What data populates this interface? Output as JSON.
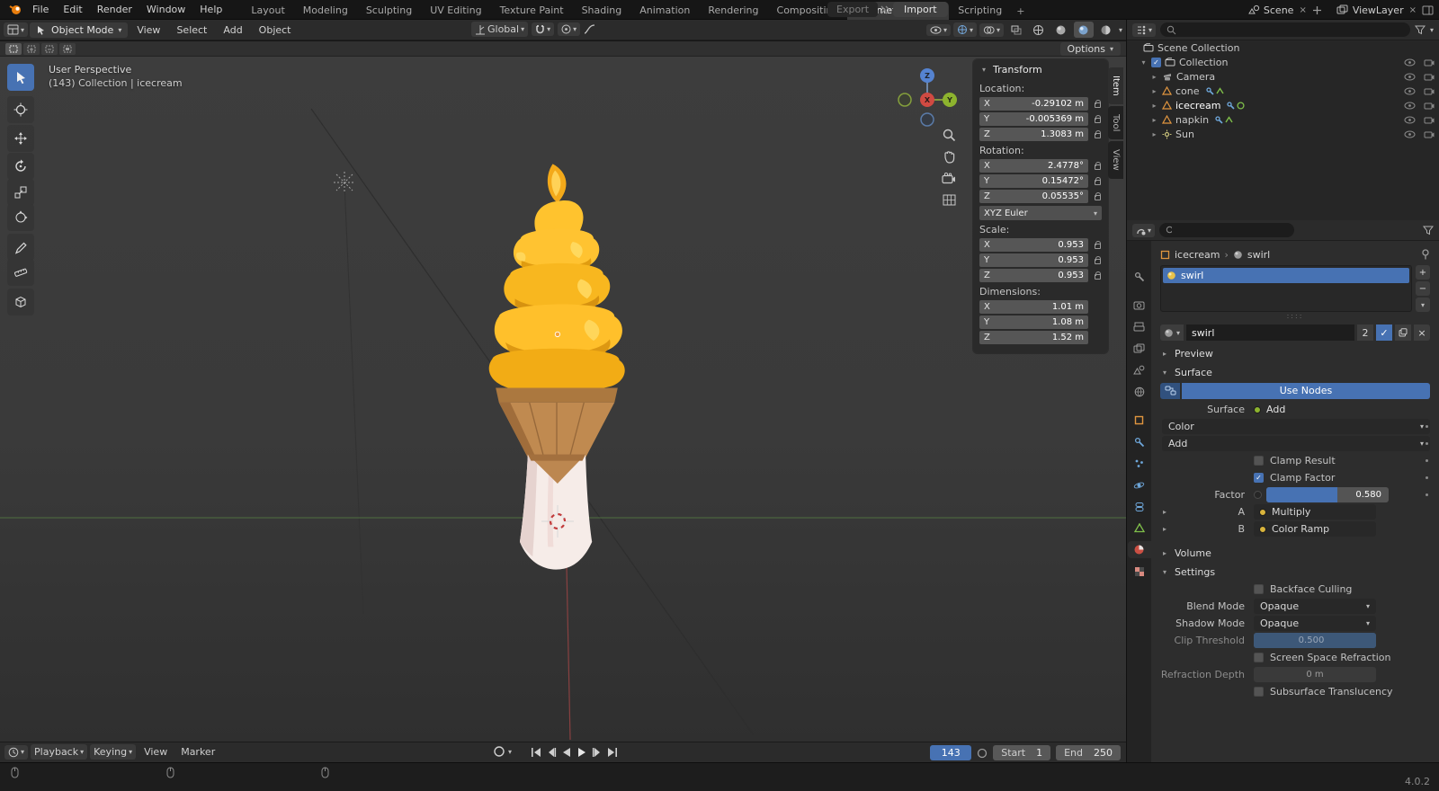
{
  "icons": {
    "chevron_down": "▾",
    "caret_right": "▸",
    "caret_down": "▾",
    "close": "×",
    "plus": "+",
    "minus": "−",
    "check": "✓",
    "handle_dots": "::::",
    "breadcrumb_sep": "›"
  },
  "topbar": {
    "menus": [
      "File",
      "Edit",
      "Render",
      "Window",
      "Help"
    ],
    "workspaces": [
      "Layout",
      "Modeling",
      "Sculpting",
      "UV Editing",
      "Texture Paint",
      "Shading",
      "Animation",
      "Rendering",
      "Compositing",
      "Geometry Nodes",
      "Scripting"
    ],
    "add_tab": "+",
    "export_label": "Export",
    "import_label": "Import",
    "scene_label": "Scene",
    "viewlayer_label": "ViewLayer"
  },
  "viewport_header": {
    "mode": "Object Mode",
    "menus": [
      "View",
      "Select",
      "Add",
      "Object"
    ],
    "orientation": "Global",
    "options_label": "Options"
  },
  "viewport": {
    "view_label": "User Perspective",
    "context_label": "(143) Collection | icecream",
    "gizmo": {
      "x": "X",
      "y": "Y",
      "z": "Z"
    }
  },
  "npanel": {
    "title": "Transform",
    "location_label": "Location:",
    "rotation_label": "Rotation:",
    "scale_label": "Scale:",
    "dimensions_label": "Dimensions:",
    "axis": {
      "x": "X",
      "y": "Y",
      "z": "Z"
    },
    "location": {
      "x": "-0.29102 m",
      "y": "-0.005369 m",
      "z": "1.3083 m"
    },
    "rotation": {
      "x": "2.4778°",
      "y": "0.15472°",
      "z": "0.05535°"
    },
    "euler_mode": "XYZ Euler",
    "scale": {
      "x": "0.953",
      "y": "0.953",
      "z": "0.953"
    },
    "dimensions": {
      "x": "1.01 m",
      "y": "1.08 m",
      "z": "1.52 m"
    },
    "tabs": [
      "Item",
      "Tool",
      "View"
    ]
  },
  "outliner": {
    "scene_collection": "Scene Collection",
    "collection": "Collection",
    "items": [
      {
        "name": "Camera"
      },
      {
        "name": "cone"
      },
      {
        "name": "icecream"
      },
      {
        "name": "napkin"
      },
      {
        "name": "Sun"
      }
    ]
  },
  "properties": {
    "breadcrumb": {
      "object": "icecream",
      "material": "swirl"
    },
    "slot": {
      "name": "swirl"
    },
    "material": {
      "name": "swirl",
      "users": "2"
    },
    "panels": {
      "preview": "Preview",
      "surface": "Surface",
      "volume": "Volume",
      "settings": "Settings"
    },
    "surface": {
      "use_nodes": "Use Nodes",
      "surface_label": "Surface",
      "surface_value": "Add",
      "color_label": "Color",
      "blend_label": "Add",
      "clamp_result": "Clamp Result",
      "clamp_factor": "Clamp Factor",
      "factor_label": "Factor",
      "factor_value": "0.580",
      "a_label": "A",
      "a_value": "Multiply",
      "b_label": "B",
      "b_value": "Color Ramp"
    },
    "settings": {
      "backface": "Backface Culling",
      "blend_mode_label": "Blend Mode",
      "blend_mode": "Opaque",
      "shadow_mode_label": "Shadow Mode",
      "shadow_mode": "Opaque",
      "clip_label": "Clip Threshold",
      "clip_value": "0.500",
      "ssr": "Screen Space Refraction",
      "refraction_label": "Refraction Depth",
      "refraction_value": "0 m",
      "subsurface": "Subsurface Translucency"
    }
  },
  "timeline": {
    "playback": "Playback",
    "keying": "Keying",
    "view": "View",
    "marker": "Marker",
    "current_frame": "143",
    "start_label": "Start",
    "start": "1",
    "end_label": "End",
    "end": "250"
  },
  "statusbar": {
    "version": "4.0.2"
  }
}
